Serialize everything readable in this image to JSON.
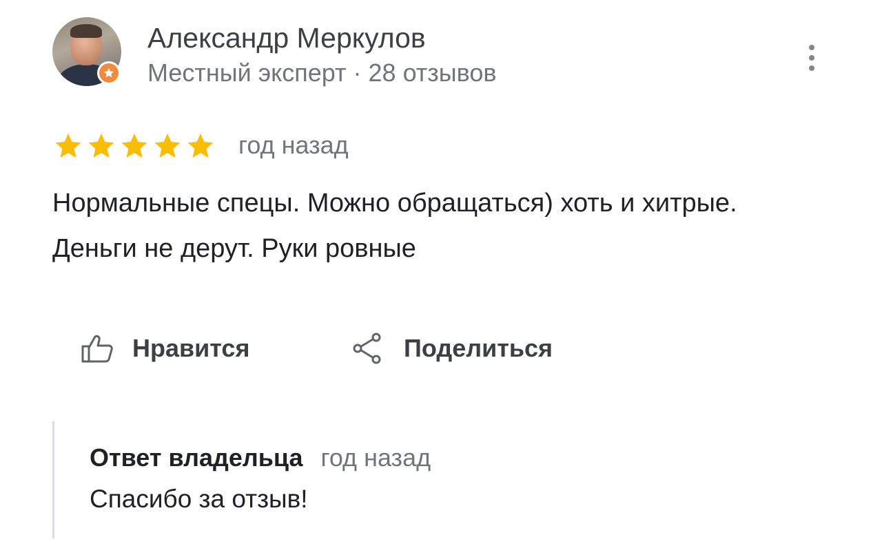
{
  "review": {
    "author": {
      "name": "Александр Меркулов",
      "meta": "Местный эксперт · 28 отзывов",
      "badge_icon": "star-badge-icon",
      "badge_color": "#f18a3b"
    },
    "rating": 5,
    "max_rating": 5,
    "star_color": "#fbbc04",
    "time": "год назад",
    "text": "Нормальные спецы. Можно обращаться) хоть и хитрые. Деньги не дерут. Руки ровные",
    "actions": {
      "like_label": "Нравится",
      "like_icon": "thumbs-up-icon",
      "share_label": "Поделиться",
      "share_icon": "share-icon"
    },
    "menu_icon": "more-vertical-icon"
  },
  "owner_reply": {
    "title": "Ответ владельца",
    "time": "год назад",
    "text": "Спасибо за отзыв!"
  }
}
